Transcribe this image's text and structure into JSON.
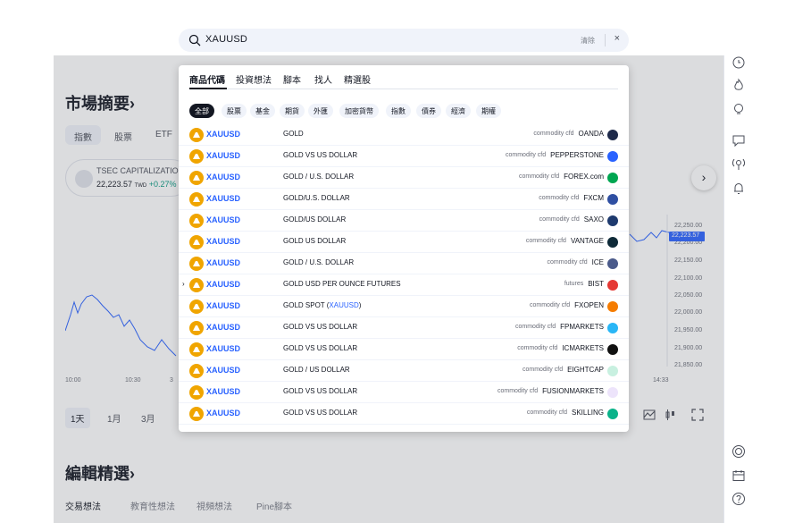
{
  "search": {
    "value": "XAUUSD",
    "clear_label": "清除",
    "close_label": "×"
  },
  "background": {
    "market_title": "市場摘要",
    "market_title_arrow": "›",
    "tabs": [
      {
        "label": "指數"
      },
      {
        "label": "股票"
      },
      {
        "label": "ETF"
      }
    ],
    "card": {
      "name": "TSEC CAPITALIZATION",
      "value": "22,223.57",
      "unit": "TWD",
      "change": "+0.27%"
    },
    "next_label": "›",
    "price_labels": [
      "22,250.00",
      "22,200.00",
      "22,150.00",
      "22,100.00",
      "22,050.00",
      "22,000.00",
      "21,950.00",
      "21,900.00",
      "21,850.00"
    ],
    "current_price": "22,223.57",
    "time_labels": [
      "10:00",
      "10:30",
      "3",
      "14:33"
    ],
    "periods": [
      {
        "label": "1天"
      },
      {
        "label": "1月"
      },
      {
        "label": "3月"
      }
    ],
    "editors_title": "編輯精選",
    "editors_title_arrow": "›",
    "bottom_tabs": [
      {
        "label": "交易想法"
      },
      {
        "label": "教育性想法"
      },
      {
        "label": "視頻想法"
      },
      {
        "label": "Pine腳本"
      }
    ]
  },
  "popup": {
    "tabs": [
      {
        "label": "商品代碼"
      },
      {
        "label": "投資想法"
      },
      {
        "label": "腳本"
      },
      {
        "label": "找人"
      },
      {
        "label": "精選股"
      }
    ],
    "chips": [
      {
        "label": "全部"
      },
      {
        "label": "股票"
      },
      {
        "label": "基金"
      },
      {
        "label": "期貨"
      },
      {
        "label": "外匯"
      },
      {
        "label": "加密貨幣"
      },
      {
        "label": "指數"
      },
      {
        "label": "債券"
      },
      {
        "label": "經濟"
      },
      {
        "label": "期權"
      }
    ],
    "rows": [
      {
        "symbol": "XAUUSD",
        "desc": "GOLD",
        "desc_hl": "",
        "type": "commodity cfd",
        "exchange": "OANDA",
        "icon_color": "#1e2a4a"
      },
      {
        "symbol": "XAUUSD",
        "desc": "GOLD VS US DOLLAR",
        "desc_hl": "",
        "type": "commodity cfd",
        "exchange": "PEPPERSTONE",
        "icon_color": "#2962ff"
      },
      {
        "symbol": "XAUUSD",
        "desc": "GOLD / U.S. DOLLAR",
        "desc_hl": "",
        "type": "commodity cfd",
        "exchange": "FOREX.com",
        "icon_color": "#00a651"
      },
      {
        "symbol": "XAUUSD",
        "desc": "GOLD/U.S. DOLLAR",
        "desc_hl": "",
        "type": "commodity cfd",
        "exchange": "FXCM",
        "icon_color": "#2f4fa2"
      },
      {
        "symbol": "XAUUSD",
        "desc": "GOLD/US DOLLAR",
        "desc_hl": "",
        "type": "commodity cfd",
        "exchange": "SAXO",
        "icon_color": "#1e3a6e"
      },
      {
        "symbol": "XAUUSD",
        "desc": "GOLD US DOLLAR",
        "desc_hl": "",
        "type": "commodity cfd",
        "exchange": "VANTAGE",
        "icon_color": "#0e2a38"
      },
      {
        "symbol": "XAUUSD",
        "desc": "GOLD / U.S. DOLLAR",
        "desc_hl": "",
        "type": "commodity cfd",
        "exchange": "ICE",
        "icon_color": "#4a5a8a"
      },
      {
        "symbol": "XAUUSD",
        "desc": "GOLD USD PER OUNCE FUTURES",
        "desc_hl": "",
        "type": "futures",
        "exchange": "BIST",
        "icon_color": "#e53935",
        "caret": "›"
      },
      {
        "symbol": "XAUUSD",
        "desc": "GOLD SPOT (",
        "desc_hl": "XAUUSD",
        "desc_tail": ")",
        "type": "commodity cfd",
        "exchange": "FXOPEN",
        "icon_color": "#f57c00"
      },
      {
        "symbol": "XAUUSD",
        "desc": "GOLD VS US DOLLAR",
        "desc_hl": "",
        "type": "commodity cfd",
        "exchange": "FPMARKETS",
        "icon_color": "#29b6f6"
      },
      {
        "symbol": "XAUUSD",
        "desc": "GOLD VS US DOLLAR",
        "desc_hl": "",
        "type": "commodity cfd",
        "exchange": "ICMARKETS",
        "icon_color": "#111111"
      },
      {
        "symbol": "XAUUSD",
        "desc": "GOLD / US DOLLAR",
        "desc_hl": "",
        "type": "commodity cfd",
        "exchange": "EIGHTCAP",
        "icon_color": "#c8f0e0"
      },
      {
        "symbol": "XAUUSD",
        "desc": "GOLD VS US DOLLAR",
        "desc_hl": "",
        "type": "commodity cfd",
        "exchange": "FUSIONMARKETS",
        "icon_color": "#ede4fb"
      },
      {
        "symbol": "XAUUSD",
        "desc": "GOLD VS US DOLLAR",
        "desc_hl": "",
        "type": "commodity cfd",
        "exchange": "SKILLING",
        "icon_color": "#0ab28a"
      }
    ]
  },
  "right_icons": [
    "clock-icon",
    "fire-icon",
    "lightbulb-icon",
    "chat-icon",
    "broadcast-icon",
    "bell-icon",
    "target-icon",
    "calendar-icon",
    "help-icon"
  ]
}
